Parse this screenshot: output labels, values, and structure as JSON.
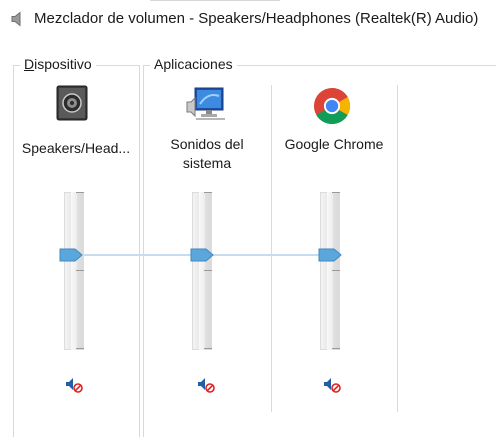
{
  "window": {
    "title": "Mezclador de volumen - Speakers/Headphones (Realtek(R) Audio)",
    "title_icon": "speaker-icon"
  },
  "groups": {
    "device": {
      "label_first": "D",
      "label_rest": "ispositivo"
    },
    "applications": {
      "label": "Aplicaciones"
    }
  },
  "channels": [
    {
      "id": "speakers",
      "name_line1": "Speakers/Head...",
      "name_line2": "",
      "icon": "speaker-device-icon",
      "volume_percent": 62,
      "muted": true
    },
    {
      "id": "system",
      "name_line1": "Sonidos del",
      "name_line2": "sistema",
      "icon": "system-sounds-icon",
      "volume_percent": 62,
      "muted": true
    },
    {
      "id": "chrome",
      "name_line1": "Google Chrome",
      "name_line2": "",
      "icon": "chrome-icon",
      "volume_percent": 62,
      "muted": true
    }
  ],
  "colors": {
    "accent": "#5ba7dc",
    "link_line": "#c7dcef",
    "frame": "#d9d9d9"
  }
}
